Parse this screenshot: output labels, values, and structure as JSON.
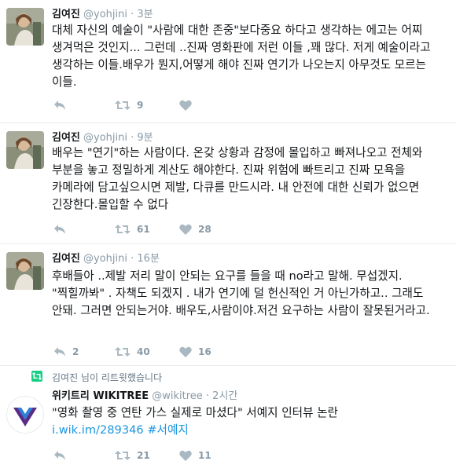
{
  "tweets": [
    {
      "name": "김여진",
      "handle": "@yohjini",
      "time": "· 3분",
      "text": "대체 자신의 예술이 \"사람에 대한 존중\"보다중요 하다고 생각하는  에고는 어찌 생겨먹은 것인지... 그런데 ..진짜 영화판에 저런 이들 ,꽤 많다. 저게 예술이라고 생각하는 이들.배우가 뭔지,어떻게 해야 진짜 연기가 나오는지 아무것도 모르는 이들.",
      "retweet_count": "9",
      "like_count": ""
    },
    {
      "name": "김여진",
      "handle": "@yohjini",
      "time": "· 9분",
      "text": "배우는 \"연기\"하는 사람이다. 온갖 상황과 감정에 몰입하고 빠져나오고 전체와 부분을 놓고 정밀하게 계산도 해야한다. 진짜 위험에 빠트리고 진짜 모욕을 카메라에 담고싶으시면 제발, 다큐를 만드시라. 내 안전에 대한 신뢰가 없으면 긴장한다.몰입할 수 없다",
      "retweet_count": "61",
      "like_count": "28"
    },
    {
      "name": "김여진",
      "handle": "@yohjini",
      "time": "· 16분",
      "text": "후배들아 ..제발 저리 말이 안되는 요구를 들을 때 no라고 말해. 무섭겠지. \"찍힐까봐\" . 자책도 되겠지 . 내가 연기에 덜 헌신적인 거 아닌가하고.. 그래도 안돼. 그러면 안되는거야. 배우도,사람이야.저건 요구하는 사람이 잘못된거라고.",
      "reply_count": "2",
      "retweet_count": "40",
      "like_count": "16"
    }
  ],
  "retweet": {
    "context": "김여진 님이 리트윗했습니다",
    "name": "위키트리 WIKITREE",
    "handle": "@wikitree",
    "time": "· 2시간",
    "text": "\"영화 촬영 중 연탄 가스 실제로 마셨다\" 서예지 인터뷰 논란",
    "link": "i.wik.im/289346",
    "hashtag": "#서예지",
    "retweet_count": "21",
    "like_count": "11"
  },
  "colors": {
    "text": "#14171a",
    "secondary": "#8899a6",
    "link": "#1b95e0",
    "action_icon": "#aab8c2",
    "retweet_badge": "#19cf86",
    "wikitree_purple": "#5b2a86"
  },
  "icons": [
    "reply-icon",
    "retweet-icon",
    "like-heart-icon"
  ]
}
